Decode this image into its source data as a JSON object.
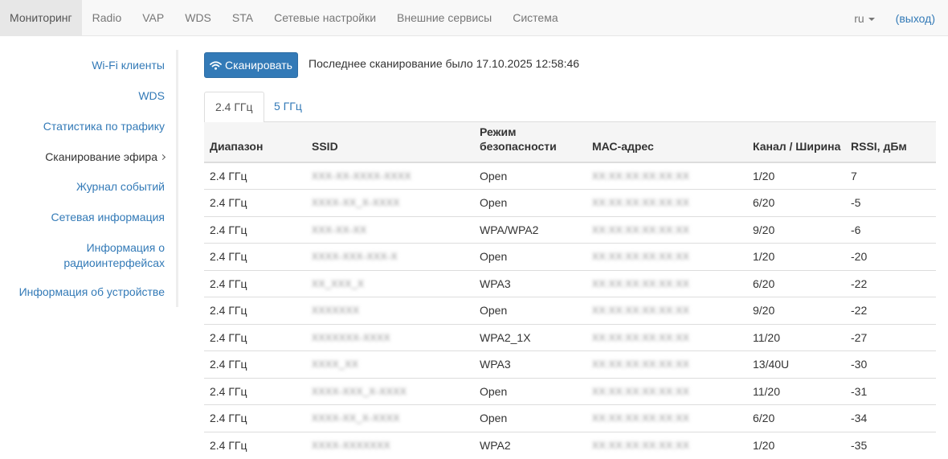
{
  "nav": {
    "tabs": [
      {
        "label": "Мониторинг",
        "active": true
      },
      {
        "label": "Radio"
      },
      {
        "label": "VAP"
      },
      {
        "label": "WDS"
      },
      {
        "label": "STA"
      },
      {
        "label": "Сетевые настройки"
      },
      {
        "label": "Внешние сервисы"
      },
      {
        "label": "Система"
      }
    ],
    "lang": "ru",
    "logout": "(выход)"
  },
  "sidebar": {
    "items": [
      {
        "label": "Wi-Fi клиенты"
      },
      {
        "label": "WDS"
      },
      {
        "label": "Статистика по трафику"
      },
      {
        "label": "Сканирование эфира",
        "active": true
      },
      {
        "label": "Журнал событий"
      },
      {
        "label": "Сетевая информация"
      },
      {
        "label_line1": "Информация о",
        "label_line2": "радиоинтерфейсах"
      },
      {
        "label": "Информация об устройстве"
      }
    ]
  },
  "main": {
    "scan_button": "Сканировать",
    "last_scan": "Последнее сканирование было 17.10.2025 12:58:46",
    "tabs": [
      {
        "label": "2.4 ГГц",
        "active": true
      },
      {
        "label": "5 ГГц"
      }
    ],
    "table": {
      "headers": {
        "band": "Диапазон",
        "ssid": "SSID",
        "security_line1": "Режим",
        "security_line2": "безопасности",
        "mac": "МАС-адрес",
        "channel": "Канал / Ширина",
        "rssi": "RSSI, дБм"
      },
      "rows": [
        {
          "band": "2.4 ГГц",
          "ssid": "XXX-XX-XXXX-XXXX",
          "security": "Open",
          "mac": "XX:XX:XX:XX:XX:XX",
          "channel": "1/20",
          "rssi": "7"
        },
        {
          "band": "2.4 ГГц",
          "ssid": "XXXX-XX_X-XXXX",
          "security": "Open",
          "mac": "XX:XX:XX:XX:XX:XX",
          "channel": "6/20",
          "rssi": "-5"
        },
        {
          "band": "2.4 ГГц",
          "ssid": "XXX-XX-XX",
          "security": "WPA/WPA2",
          "mac": "XX:XX:XX:XX:XX:XX",
          "channel": "9/20",
          "rssi": "-6"
        },
        {
          "band": "2.4 ГГц",
          "ssid": "XXXX-XXX-XXX-X",
          "security": "Open",
          "mac": "XX:XX:XX:XX:XX:XX",
          "channel": "1/20",
          "rssi": "-20"
        },
        {
          "band": "2.4 ГГц",
          "ssid": "XX_XXX_X",
          "security": "WPA3",
          "mac": "XX:XX:XX:XX:XX:XX",
          "channel": "6/20",
          "rssi": "-22"
        },
        {
          "band": "2.4 ГГц",
          "ssid": "XXXXXXX",
          "security": "Open",
          "mac": "XX:XX:XX:XX:XX:XX",
          "channel": "9/20",
          "rssi": "-22"
        },
        {
          "band": "2.4 ГГц",
          "ssid": "XXXXXXX-XXXX",
          "security": "WPA2_1X",
          "mac": "XX:XX:XX:XX:XX:XX",
          "channel": "11/20",
          "rssi": "-27"
        },
        {
          "band": "2.4 ГГц",
          "ssid": "XXXX_XX",
          "security": "WPA3",
          "mac": "XX:XX:XX:XX:XX:XX",
          "channel": "13/40U",
          "rssi": "-30"
        },
        {
          "band": "2.4 ГГц",
          "ssid": "XXXX-XXX_X-XXXX",
          "security": "Open",
          "mac": "XX:XX:XX:XX:XX:XX",
          "channel": "11/20",
          "rssi": "-31"
        },
        {
          "band": "2.4 ГГц",
          "ssid": "XXXX-XX_X-XXXX",
          "security": "Open",
          "mac": "XX:XX:XX:XX:XX:XX",
          "channel": "6/20",
          "rssi": "-34"
        },
        {
          "band": "2.4 ГГц",
          "ssid": "XXXX-XXXXXXX",
          "security": "WPA2",
          "mac": "XX:XX:XX:XX:XX:XX",
          "channel": "1/20",
          "rssi": "-35"
        }
      ]
    }
  },
  "colors": {
    "link": "#337ab7",
    "button_bg": "#337ab7",
    "navbar_bg": "#f8f8f8",
    "active_nav_bg": "#e7e7e7"
  }
}
